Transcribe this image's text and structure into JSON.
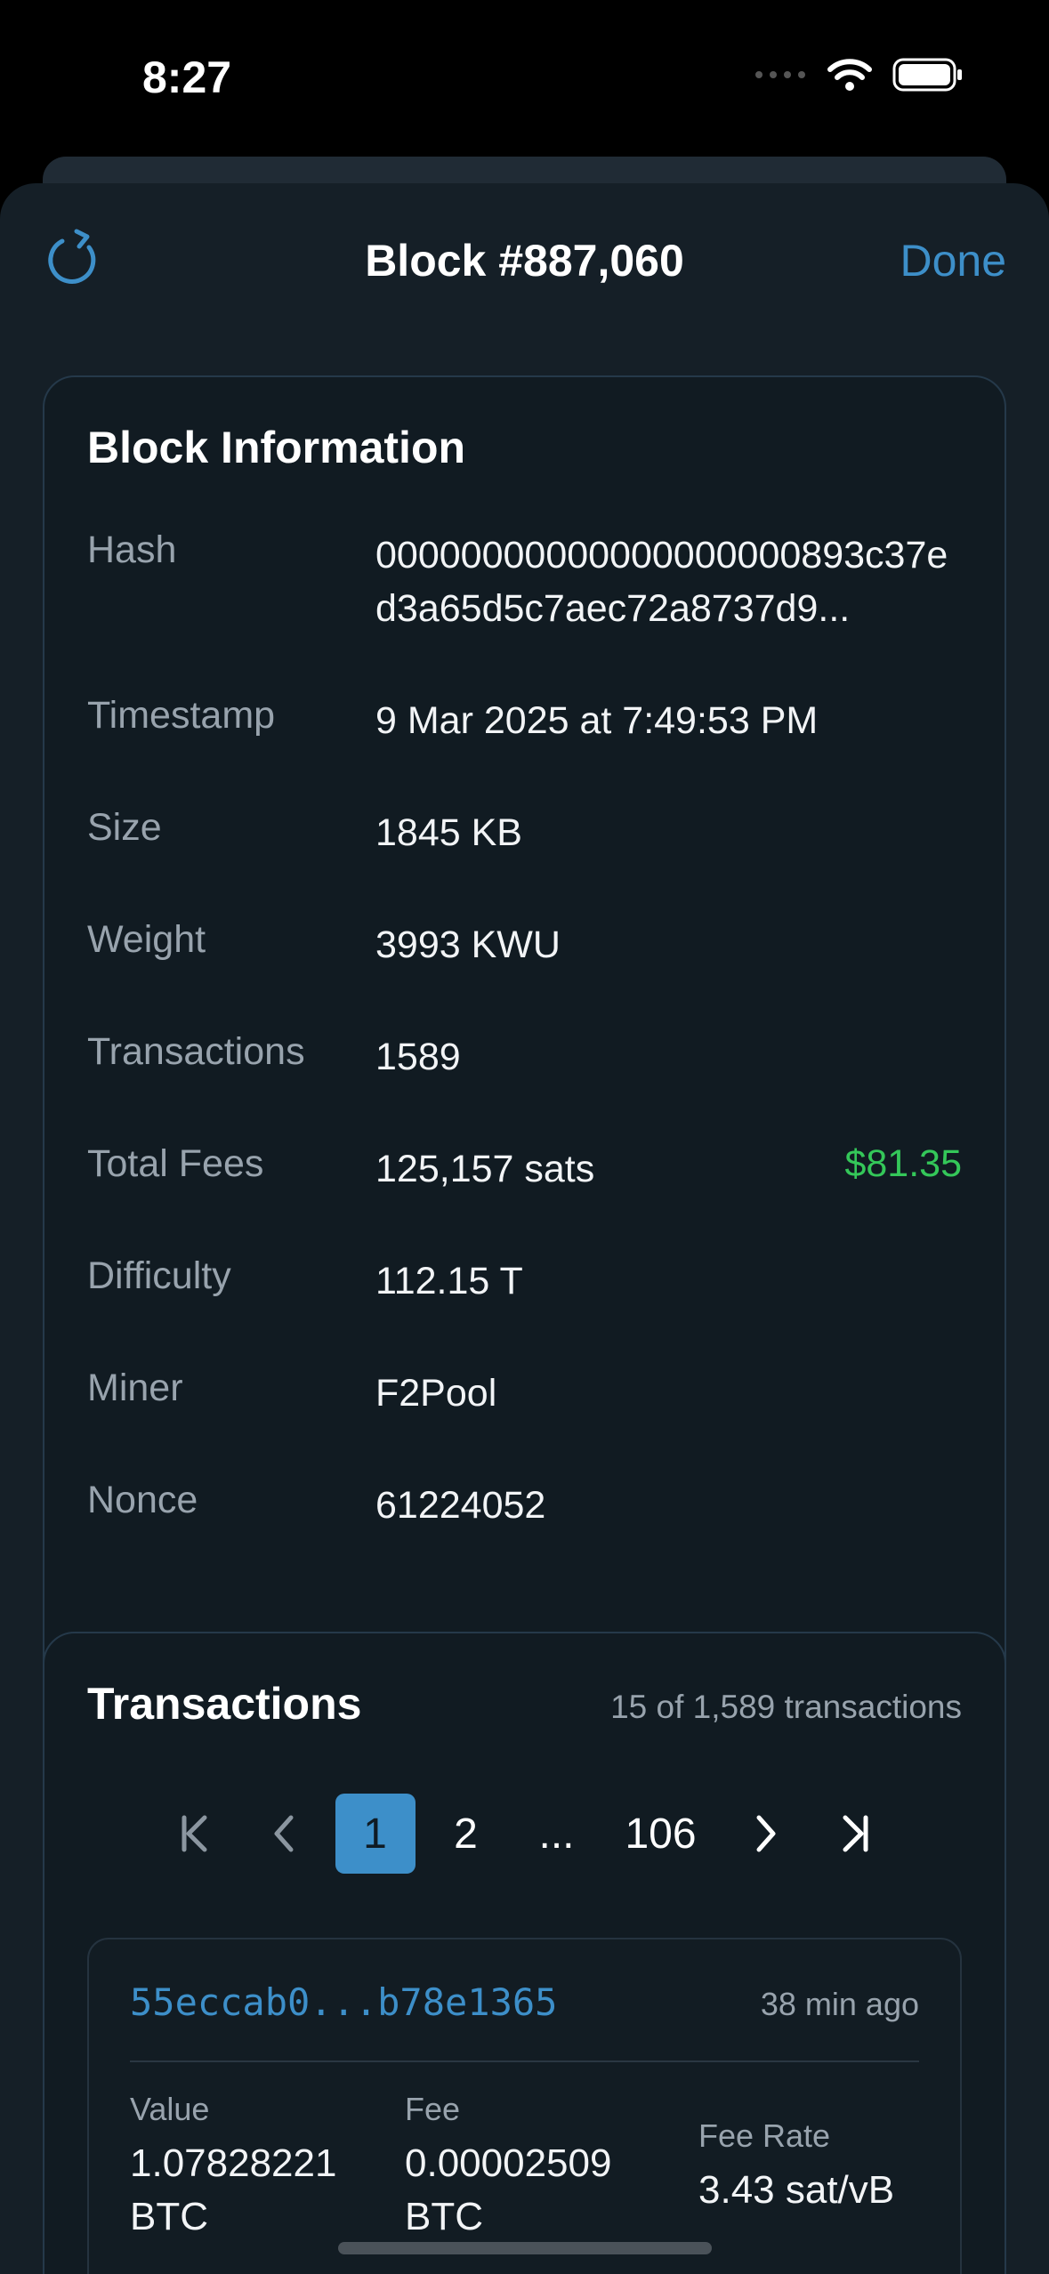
{
  "status_bar": {
    "time": "8:27"
  },
  "nav": {
    "title": "Block #887,060",
    "done_label": "Done"
  },
  "block_info": {
    "title": "Block Information",
    "rows": [
      {
        "label": "Hash",
        "value": "00000000000000000000893c37ed3a65d5c7aec72a8737d9..."
      },
      {
        "label": "Timestamp",
        "value": "9 Mar 2025 at 7:49:53 PM"
      },
      {
        "label": "Size",
        "value": "1845 KB"
      },
      {
        "label": "Weight",
        "value": "3993 KWU"
      },
      {
        "label": "Transactions",
        "value": "1589"
      },
      {
        "label": "Total Fees",
        "value": "125,157 sats",
        "usd": "$81.35"
      },
      {
        "label": "Difficulty",
        "value": "112.15 T"
      },
      {
        "label": "Miner",
        "value": "F2Pool"
      },
      {
        "label": "Nonce",
        "value": "61224052"
      }
    ]
  },
  "transactions": {
    "title": "Transactions",
    "count_text": "15 of 1,589 transactions",
    "pagination": {
      "pages": [
        "1",
        "2",
        "...",
        "106"
      ],
      "current": "1"
    },
    "items": [
      {
        "hash": "55eccab0...b78e1365",
        "time": "38 min ago",
        "value_label": "Value",
        "value": "1.07828221 BTC",
        "fee_label": "Fee",
        "fee": "0.00002509 BTC",
        "fee_rate_label": "Fee Rate",
        "fee_rate": "3.43 sat/vB"
      }
    ]
  },
  "colors": {
    "accent": "#3d8fc9",
    "positive": "#34c759",
    "background": "#151f27"
  }
}
